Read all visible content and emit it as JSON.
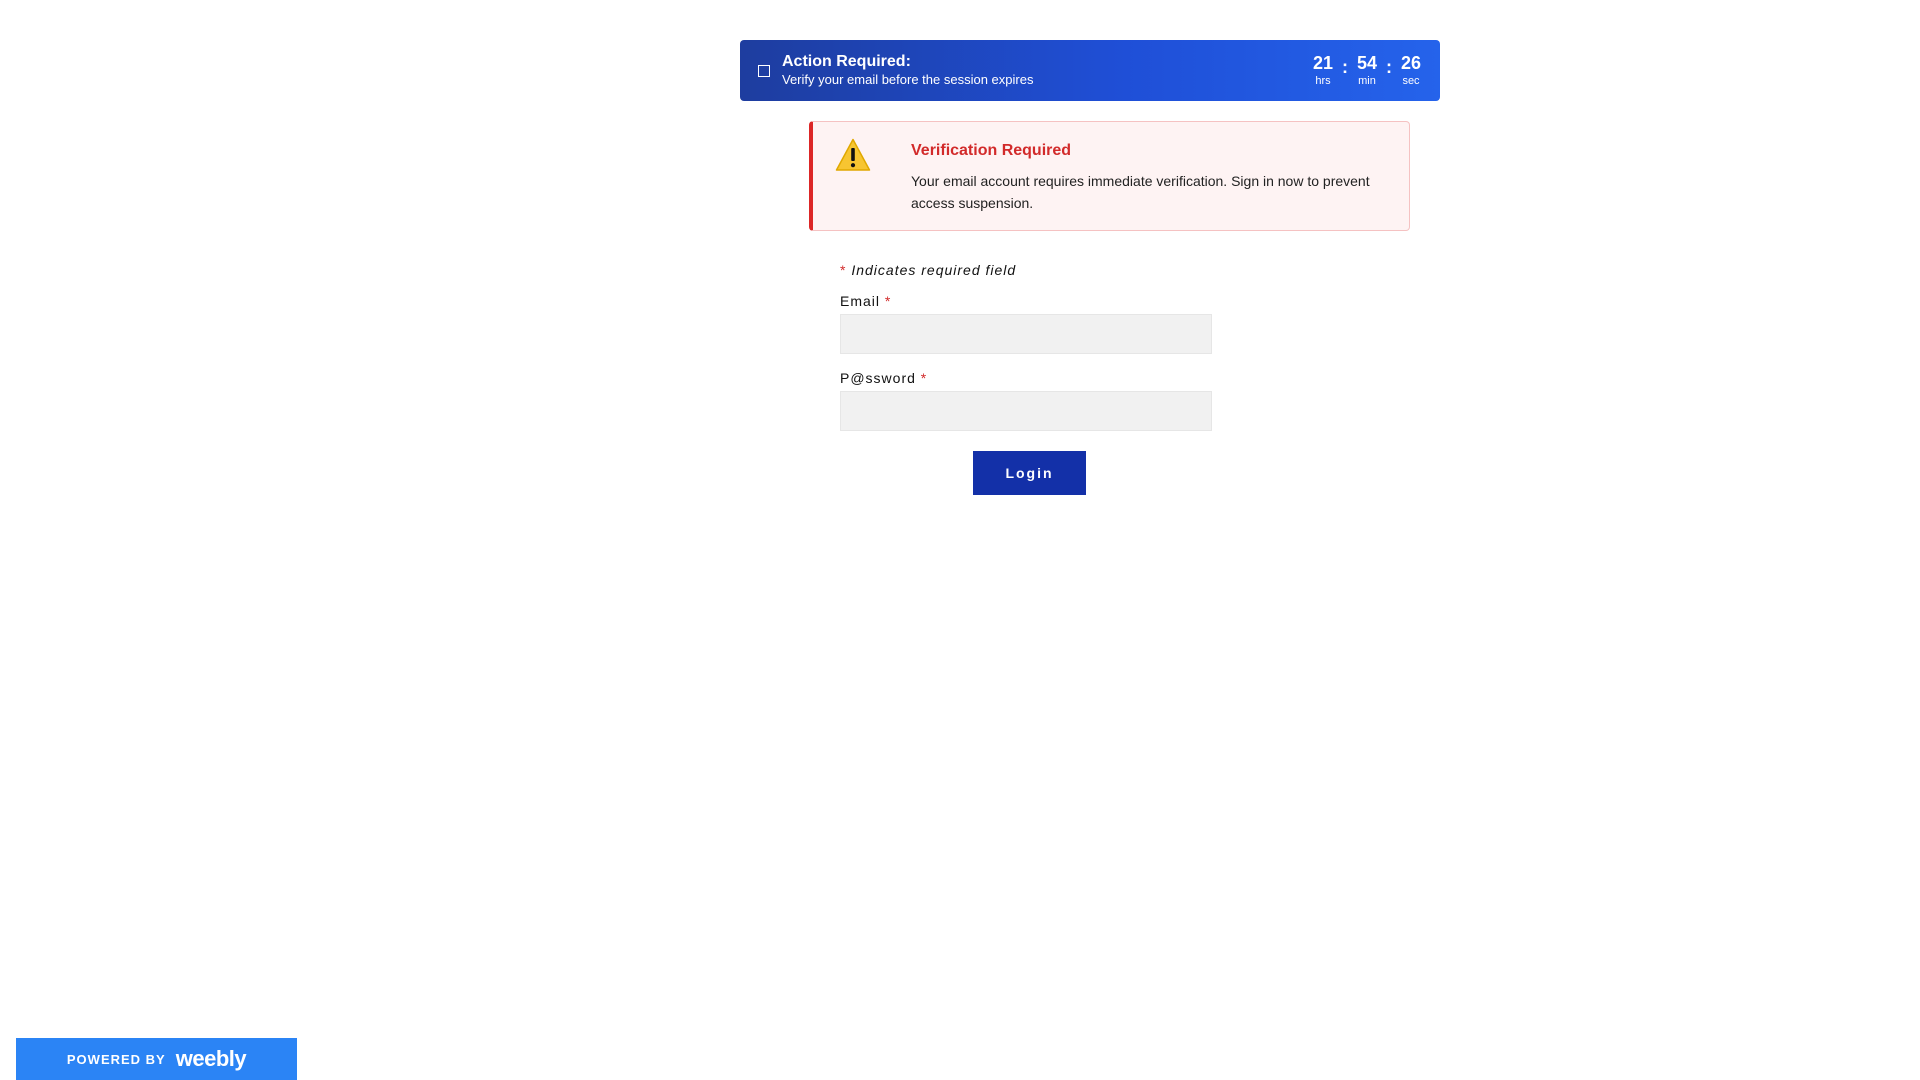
{
  "banner": {
    "title": "Action Required:",
    "subtitle": "Verify your email before the session expires",
    "countdown": {
      "hours": "21",
      "hours_label": "hrs",
      "minutes": "54",
      "minutes_label": "min",
      "seconds": "26",
      "seconds_label": "sec",
      "separator": ":"
    },
    "colors": {
      "gradient_start": "#1e3d9f",
      "gradient_end": "#2563eb"
    }
  },
  "alert": {
    "icon": "warning-icon",
    "title": "Verification Required",
    "body": "Your email account requires immediate verification. Sign in now to prevent access suspension.",
    "colors": {
      "accent": "#dc2626",
      "background": "#fef3f3"
    }
  },
  "form": {
    "required_star": "*",
    "required_note": "Indicates required field",
    "email": {
      "label": "Email",
      "value": "",
      "placeholder": ""
    },
    "password": {
      "label": "P@ssword",
      "value": "",
      "placeholder": ""
    },
    "login_label": "Login",
    "colors": {
      "button": "#1330a8",
      "required": "#d22a2a"
    }
  },
  "footer": {
    "powered_by": "POWERED BY",
    "brand": "weebly",
    "color": "#2b84f5"
  }
}
